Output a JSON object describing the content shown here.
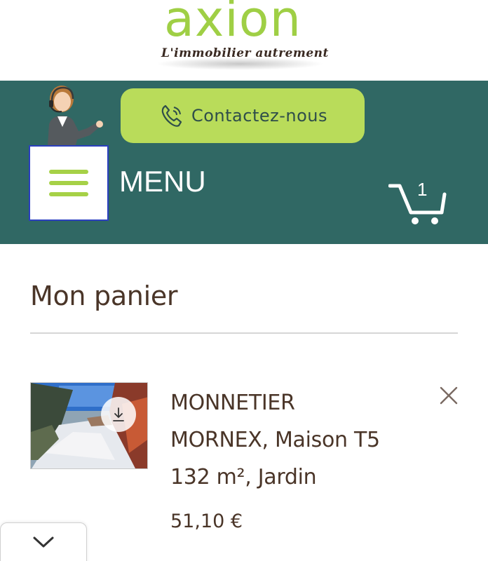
{
  "logo": {
    "brand": "axion",
    "tagline": "L'immobilier autrement"
  },
  "header": {
    "contact_label": "Contactez-nous",
    "menu_label": "MENU",
    "cart_count": "1"
  },
  "cart": {
    "title": "Mon panier",
    "items": [
      {
        "title": "MONNETIER MORNEX, Maison T5 132 m², Jardin",
        "price": "51,10 €"
      }
    ]
  },
  "colors": {
    "header_bg": "#306864",
    "accent_green": "#b9dc5a",
    "logo_green": "#9fcf45",
    "text_brown": "#4a3528"
  },
  "icons": {
    "phone": "phone-icon",
    "menu": "hamburger-icon",
    "cart": "cart-icon",
    "remove": "close-icon",
    "download": "download-icon",
    "scroll": "chevron-down-icon"
  }
}
